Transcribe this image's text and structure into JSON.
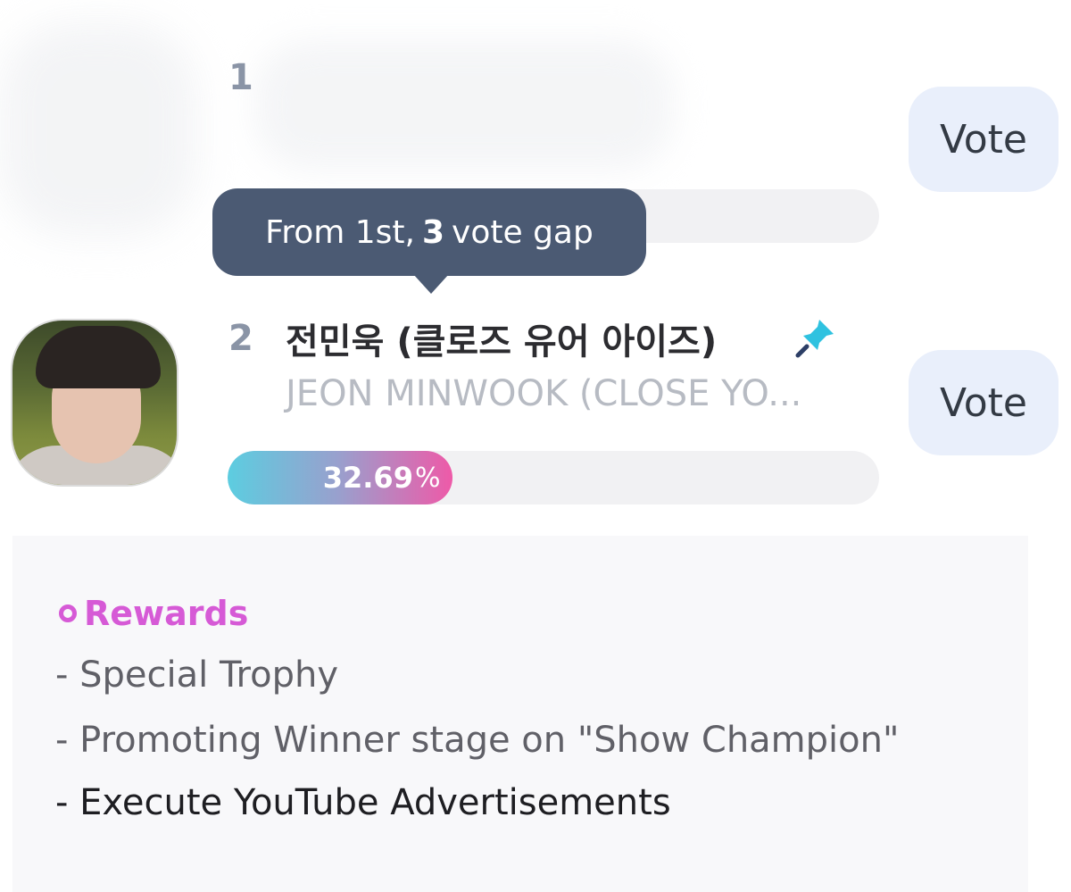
{
  "entries": [
    {
      "rank": "1",
      "vote_label": "Vote"
    },
    {
      "rank": "2",
      "name_ko": "전민욱 (클로즈 유어 아이즈)",
      "name_en": "JEON MINWOOK (CLOSE YO...",
      "percent_value": "32.69",
      "percent_sign": "%",
      "percent": 32.69,
      "vote_label": "Vote"
    }
  ],
  "tooltip": {
    "prefix": "From 1st,",
    "gap": "3",
    "suffix": "vote gap"
  },
  "rewards": {
    "title": "Rewards",
    "items": [
      "- Special Trophy",
      "- Promoting Winner stage on \"Show Champion\"",
      "- Execute YouTube Advertisements"
    ]
  },
  "colors": {
    "accent": "#d65ad6",
    "tooltip_bg": "#4b5a73",
    "vote_bg": "#e9effb",
    "gradient_start": "#5ccde0",
    "gradient_end": "#ee5aa8",
    "pin": "#2fc2e0"
  },
  "icons": {
    "pin": "pin-icon",
    "rewards_bullet": "circle-icon"
  }
}
